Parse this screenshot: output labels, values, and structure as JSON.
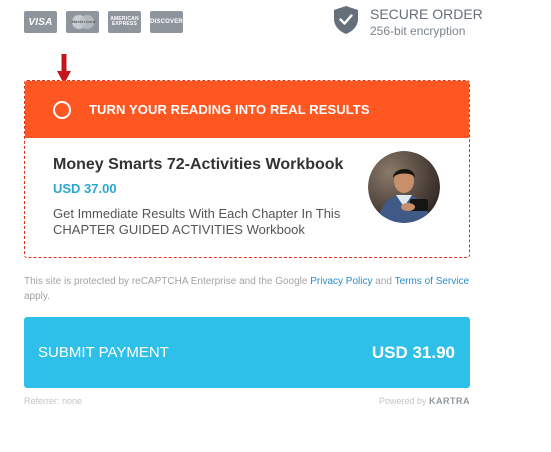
{
  "payment_cards": {
    "visa": "VISA",
    "mastercard": "MasterCard",
    "amex": "AMERICAN EXPRESS",
    "discover": "DISCOVER"
  },
  "secure": {
    "title": "SECURE ORDER",
    "subtitle": "256-bit encryption",
    "icon": "shield-check-icon"
  },
  "bump_offer": {
    "headline": "TURN YOUR READING INTO REAL RESULTS",
    "product_name": "Money Smarts 72-Activities Workbook",
    "price": "USD 37.00",
    "description": "Get Immediate Results With Each Chapter In This CHAPTER GUIDED ACTIVITIES Workbook",
    "selected": false
  },
  "legal": {
    "prefix": "This site is protected by reCAPTCHA Enterprise and the Google",
    "privacy_link": "Privacy Policy",
    "and": "and",
    "terms_link": "Terms of Service",
    "suffix": "apply."
  },
  "submit": {
    "label": "SUBMIT PAYMENT",
    "amount": "USD 31.90"
  },
  "footer": {
    "referrer": "Referrer: none",
    "powered_by": "Powered by",
    "brand": "KARTRA"
  },
  "colors": {
    "offer_header": "#ff5722",
    "offer_border": "#e2341d",
    "price": "#2aa8d0",
    "submit_bg": "#2ec0e8",
    "arrow": "#c3161c",
    "link": "#2a8cc8"
  }
}
